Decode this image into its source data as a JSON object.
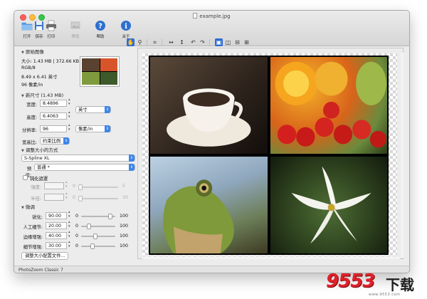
{
  "window": {
    "title": "example.jpg"
  },
  "toolbar": {
    "buttons": [
      {
        "label": "打开",
        "icon": "folder-icon"
      },
      {
        "label": "保存",
        "icon": "save-disk-icon"
      },
      {
        "label": "打印",
        "icon": "printer-icon"
      },
      {
        "label": "预览",
        "icon": "preview-icon",
        "disabled": true
      },
      {
        "label": "帮助",
        "icon": "help-icon"
      },
      {
        "label": "关于",
        "icon": "info-icon"
      }
    ]
  },
  "view_tools": [
    "hand-tool-icon",
    "zoom-tool-icon",
    "crop-tool-icon",
    "flip-horizontal-icon",
    "flip-vertical-icon",
    "rotate-left-icon",
    "rotate-right-icon",
    "view-single-icon",
    "view-split-vertical-icon",
    "view-split-horizontal-icon",
    "view-quad-icon"
  ],
  "original": {
    "header": "原始图像",
    "size_line": "大小: 1.43 MB | 372.66 KB",
    "mode": "RGB/8",
    "dimensions": "8.49 x 6.41 英寸",
    "resolution": "96 像素/in"
  },
  "new_size": {
    "header": "新尺寸 (1.43 MB)",
    "width_label": "宽度:",
    "width_value": "8.4896",
    "height_label": "高度:",
    "height_value": "6.4063",
    "unit": "英寸",
    "resolution_label": "分辨率:",
    "resolution_value": "96",
    "resolution_unit": "像素/in",
    "aspect_label": "宽高比:",
    "aspect_value": "约束比例"
  },
  "resize_method": {
    "header": "调整大小的方式",
    "method": "S-Spline XL",
    "preset_label": "预设:",
    "preset_value": "普通 *"
  },
  "sharpen": {
    "label": "钝化遮罩",
    "strength_label": "强度:",
    "radius_label": "半径:",
    "min": "0",
    "strength_max": "5",
    "radius_max": "10"
  },
  "fine_tune": {
    "header": "微调",
    "rows": [
      {
        "label": "锐化:",
        "value": "90.00",
        "min": "0",
        "max": "100",
        "level": 0.9
      },
      {
        "label": "人工细节:",
        "value": "20.00",
        "min": "0",
        "max": "100",
        "level": 0.2
      },
      {
        "label": "边缘增强:",
        "value": "40.00",
        "min": "0",
        "max": "100",
        "level": 0.4
      },
      {
        "label": "细节增强:",
        "value": "30.00",
        "min": "0",
        "max": "100",
        "level": 0.3
      }
    ],
    "profile_button": "调整大小配置文件..."
  },
  "status": {
    "text": "PhotoZoom Classic 7"
  },
  "watermark": {
    "brand": "9553",
    "suffix": "下载",
    "url": "www.9553.com"
  },
  "colors": {
    "accent": "#3d86ea",
    "active_tool": "#2d6bd6",
    "watermark_red": "#e0202a"
  }
}
